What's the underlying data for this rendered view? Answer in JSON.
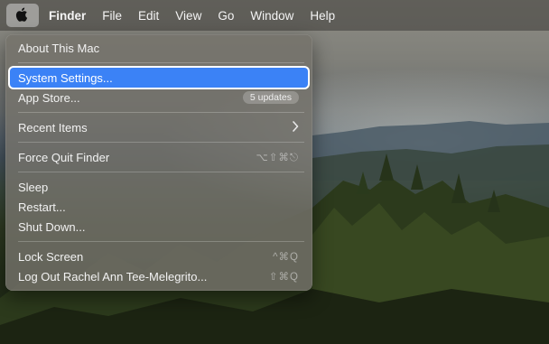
{
  "menubar": {
    "apple_icon": "apple-logo-icon",
    "items": [
      "Finder",
      "File",
      "Edit",
      "View",
      "Go",
      "Window",
      "Help"
    ]
  },
  "apple_menu": {
    "items": [
      {
        "label": "About This Mac"
      },
      {
        "label": "System Settings...",
        "highlighted": true
      },
      {
        "label": "App Store...",
        "badge": "5 updates"
      },
      {
        "label": "Recent Items",
        "submenu_icon": "chevron-right-icon"
      },
      {
        "label": "Force Quit Finder",
        "shortcut": "⌥⇧⌘⎋"
      },
      {
        "label": "Sleep"
      },
      {
        "label": "Restart..."
      },
      {
        "label": "Shut Down..."
      },
      {
        "label": "Lock Screen",
        "shortcut": "^⌘Q"
      },
      {
        "label": "Log Out Rachel Ann Tee-Melegrito...",
        "shortcut": "⇧⌘Q"
      }
    ]
  },
  "colors": {
    "highlight": "#3b82f6",
    "menu_background": "#74716a"
  }
}
